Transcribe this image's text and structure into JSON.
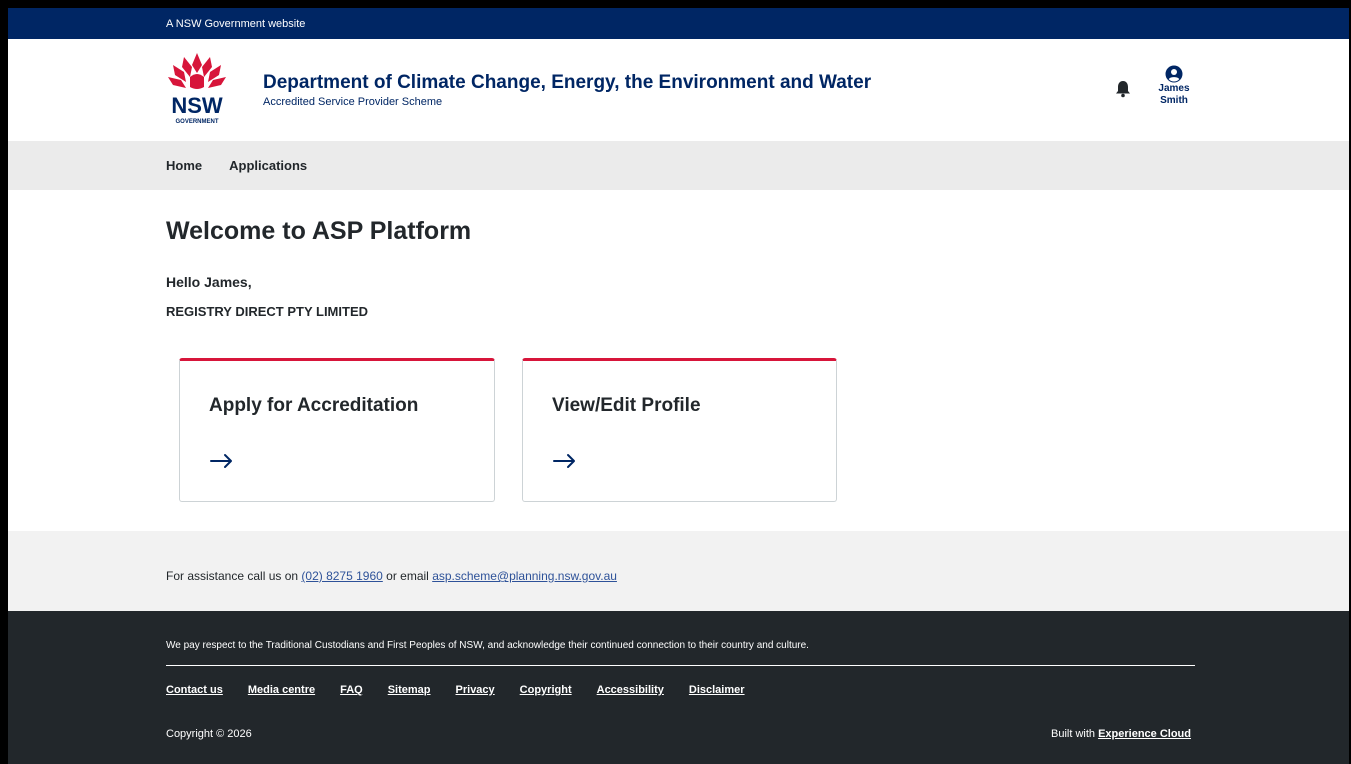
{
  "gov_bar": {
    "text": "A NSW Government website"
  },
  "logo": {
    "word": "NSW",
    "subword": "GOVERNMENT"
  },
  "header": {
    "title": "Department of Climate Change, Energy, the Environment and Water",
    "subtitle": "Accredited Service Provider Scheme"
  },
  "user": {
    "first_name": "James",
    "last_name": "Smith"
  },
  "nav": {
    "items": [
      {
        "label": "Home"
      },
      {
        "label": "Applications"
      }
    ]
  },
  "main": {
    "title": "Welcome to ASP Platform",
    "greeting": "Hello James,",
    "company": "REGISTRY DIRECT PTY LIMITED",
    "cards": [
      {
        "title": "Apply for Accreditation"
      },
      {
        "title": "View/Edit Profile"
      }
    ]
  },
  "assistance": {
    "prefix": "For assistance call us on",
    "phone": "(02) 8275 1960",
    "middle": "or email",
    "email": "asp.scheme@planning.nsw.gov.au"
  },
  "footer": {
    "acknowledgement": "We pay respect to the Traditional Custodians and First Peoples of NSW, and acknowledge their continued connection to their country and culture.",
    "links": [
      {
        "label": "Contact us"
      },
      {
        "label": "Media centre"
      },
      {
        "label": "FAQ"
      },
      {
        "label": "Sitemap"
      },
      {
        "label": "Privacy"
      },
      {
        "label": "Copyright"
      },
      {
        "label": "Accessibility"
      },
      {
        "label": "Disclaimer"
      }
    ],
    "copyright": "Copyright © 2026",
    "built_prefix": "Built with",
    "built_link": "Experience Cloud"
  },
  "colors": {
    "navy": "#002664",
    "red": "#d7153a",
    "footer_bg": "#22272b",
    "nav_bg": "#ebebeb",
    "link": "#2e5299"
  },
  "icons": {
    "logo": "nsw-waratah-logo",
    "notifications": "bell-icon",
    "user": "user-circle-icon",
    "card_action": "arrow-right-icon"
  }
}
